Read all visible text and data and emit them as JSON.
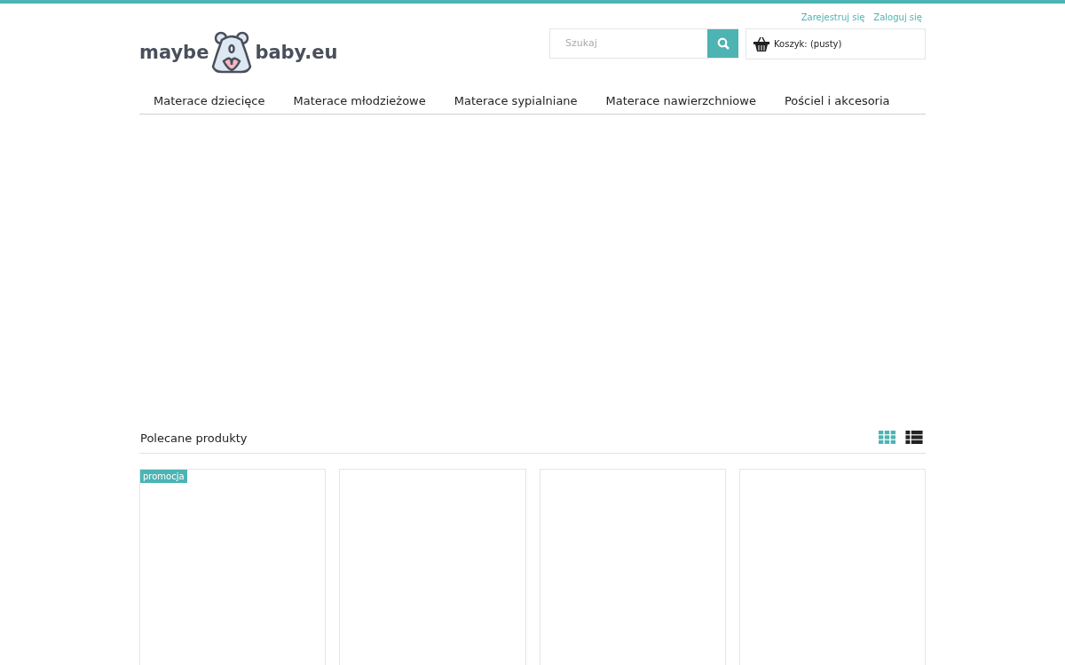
{
  "header": {
    "links": [
      "Zarejestruj się",
      "Zaloguj się"
    ],
    "logo": {
      "left": "maybe",
      "right": "baby.eu"
    },
    "search": {
      "placeholder": "Szukaj"
    },
    "cart": {
      "label": "Koszyk: (pusty)"
    }
  },
  "menu": [
    "Materace dziecięce",
    "Materace młodzieżowe",
    "Materace sypialniane",
    "Materace nawierzchniowe",
    "Pościel i akcesoria"
  ],
  "featured": {
    "title": "Polecane produkty",
    "views": [
      {
        "kind": "grid",
        "selected": true
      },
      {
        "kind": "list",
        "selected": false
      }
    ],
    "products": [
      {
        "kind": "promo",
        "badge": "promocja"
      },
      {
        "kind": "plain"
      },
      {
        "kind": "plain"
      },
      {
        "kind": "plain"
      }
    ]
  }
}
